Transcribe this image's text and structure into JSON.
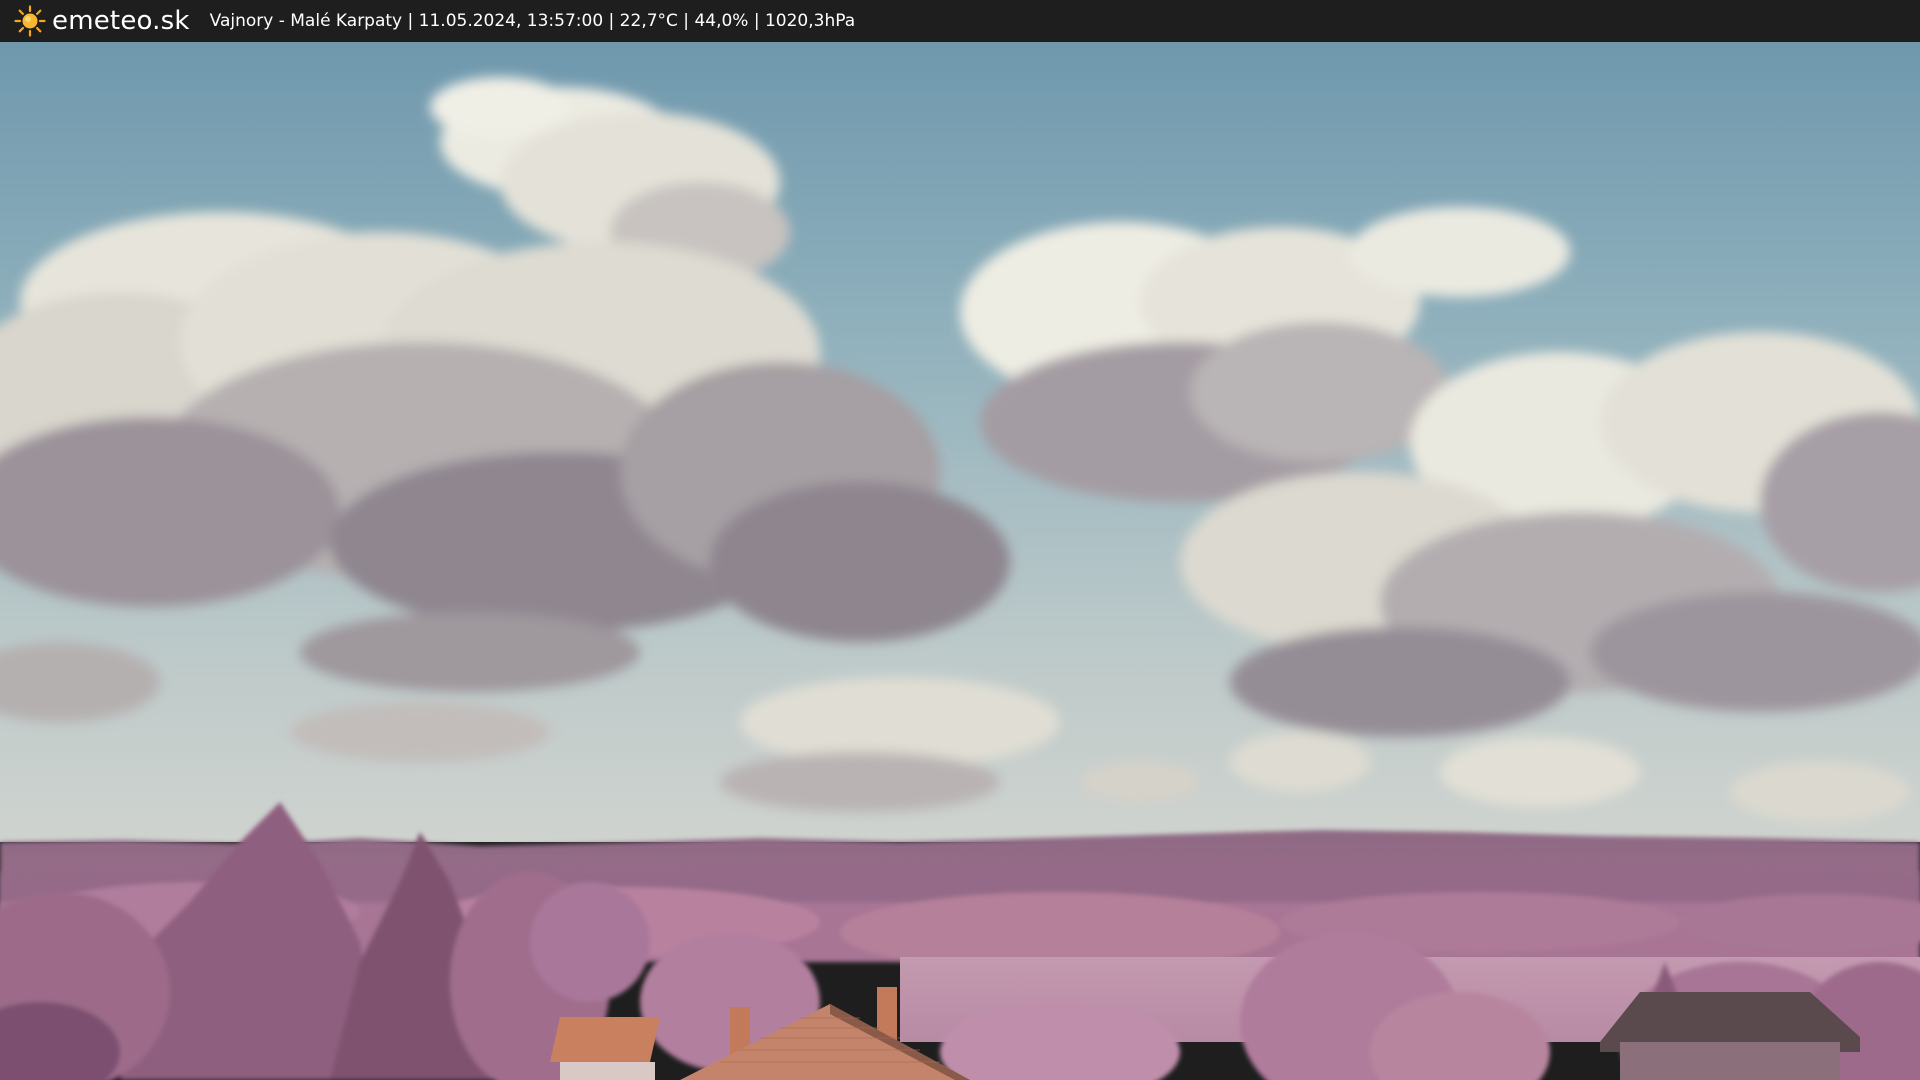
{
  "header": {
    "brand": "emeteo.sk",
    "caption": "Vajnory - Malé Karpaty | 11.05.2024, 13:57:00 | 22,7°C | 44,0% | 1020,3hPa"
  },
  "icons": {
    "logo": "sun-icon"
  },
  "colors": {
    "header_bg": "#1e1e1e",
    "header_text": "#ffffff",
    "sun": "#f5a623",
    "sky_top": "#6f98ad",
    "sky_bottom": "#c9d2d0",
    "hills": "#8e5f7e",
    "foliage": "#b0789c",
    "roof": "#c9805f"
  }
}
